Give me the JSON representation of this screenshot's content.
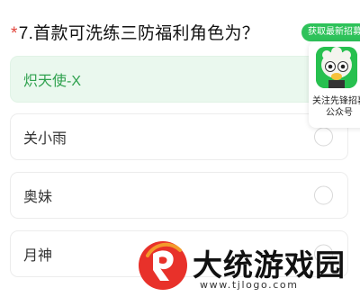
{
  "question": {
    "required_mark": "*",
    "text": "7.首款可洗练三防福利角色为？"
  },
  "options": [
    {
      "label": "炽天使-X",
      "selected": true
    },
    {
      "label": "关小雨",
      "selected": false
    },
    {
      "label": "奥妹",
      "selected": false
    },
    {
      "label": "月神",
      "selected": false
    }
  ],
  "promo": {
    "pill_text": "获取最新招募码",
    "line1": "关注先锋招募",
    "line2": "公众号",
    "logo_icon": "cartoon-mascot-icon",
    "accent_color": "#2ec25a"
  },
  "watermark": {
    "title": "大统游戏园",
    "url": "www.tjlogo.com",
    "logo_icon": "brand-logo-icon",
    "logo_color": "#e8312a"
  },
  "colors": {
    "selected_bg": "#eaf8ee",
    "selected_text": "#2fa14e",
    "required": "#e2453c"
  }
}
